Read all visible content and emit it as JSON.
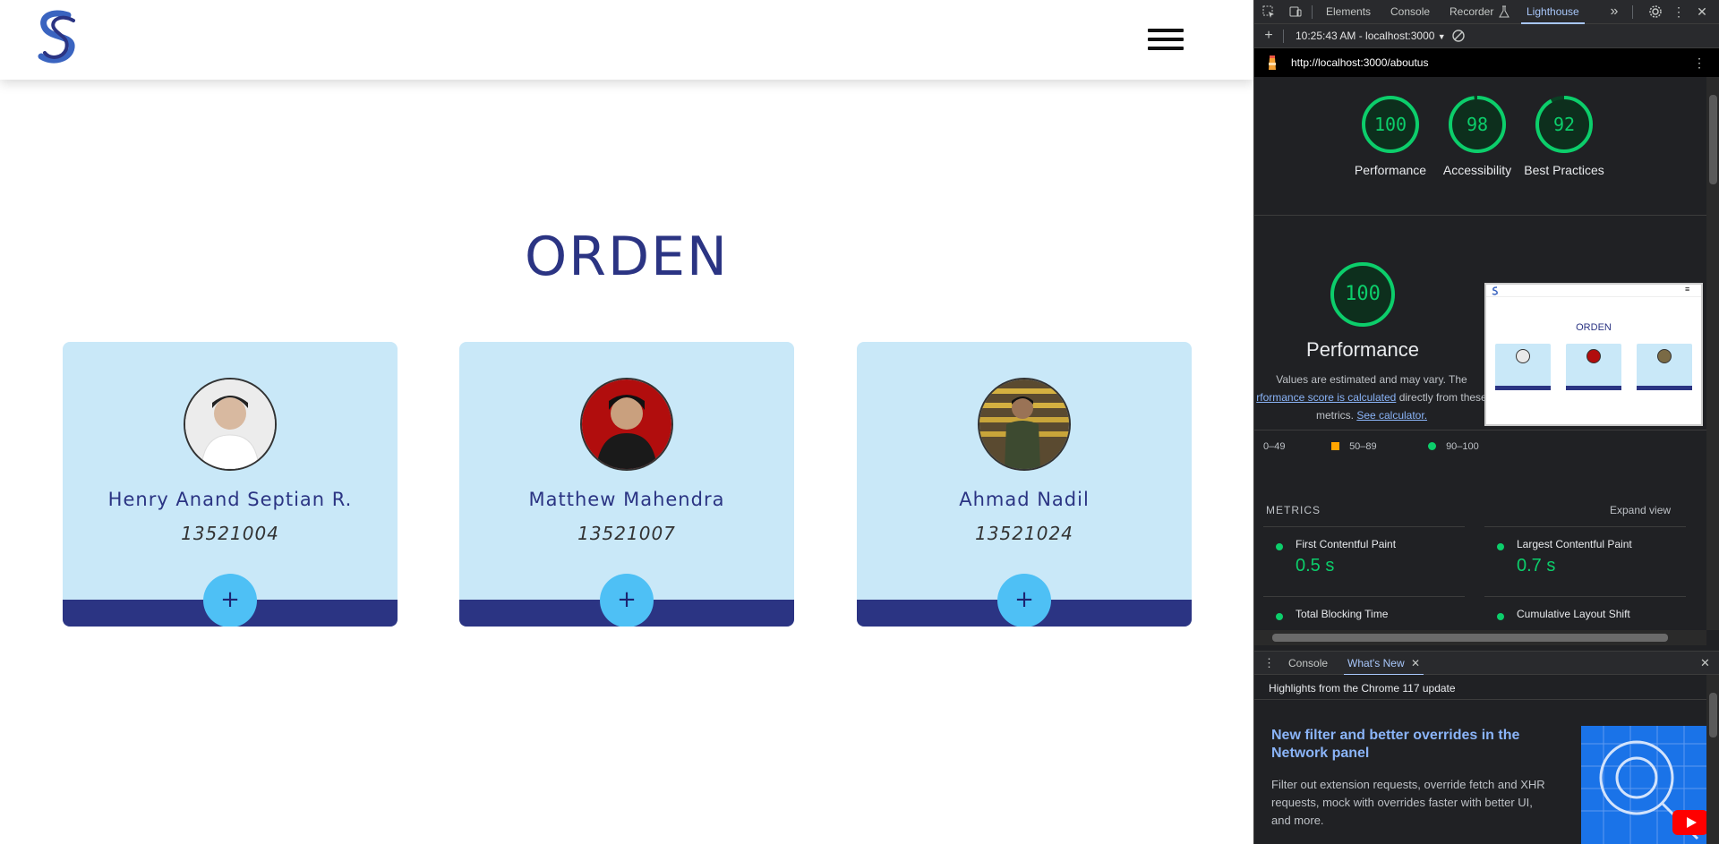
{
  "site": {
    "logo_icon": "orden-s-logo-icon",
    "title": "ORDEN",
    "members": [
      {
        "name": "Henry Anand Septian R.",
        "nim": "13521004",
        "avatar_bg": "#e9e9e9",
        "plus": "+"
      },
      {
        "name": "Matthew Mahendra",
        "nim": "13521007",
        "avatar_bg": "#b10d0d",
        "plus": "+"
      },
      {
        "name": "Ahmad Nadil",
        "nim": "13521024",
        "avatar_bg": "#7a6a45",
        "plus": "+"
      }
    ],
    "colors": {
      "primary": "#2b3483",
      "card_bg": "#c9e8f8",
      "button": "#4ec0f5"
    }
  },
  "devtools": {
    "tabs": [
      "Elements",
      "Console",
      "Recorder",
      "Lighthouse"
    ],
    "active_tab": "Lighthouse",
    "report_selector": "10:25:43 AM - localhost:3000",
    "url": "http://localhost:3000/aboutus",
    "scores": [
      {
        "value": "100",
        "label": "Performance",
        "fraction": 1.0
      },
      {
        "value": "98",
        "label": "Accessibility",
        "fraction": 0.98
      },
      {
        "value": "92",
        "label": "Best Practices",
        "fraction": 0.92
      }
    ],
    "performance": {
      "value": "100",
      "fraction": 1.0,
      "title": "Performance",
      "desc_prefix": "Values are estimated and may vary. The",
      "desc_link1": "rformance score is calculated",
      "desc_mid": "directly from these",
      "desc_suffix": "metrics.",
      "desc_link2": "See calculator."
    },
    "thumbnail": {
      "title": "ORDEN",
      "menu": "≡"
    },
    "legend": [
      {
        "label": "0–49",
        "color": "#ff4e42"
      },
      {
        "label": "50–89",
        "color": "#ffa400"
      },
      {
        "label": "90–100",
        "color": "#0cce6b"
      }
    ],
    "metrics_heading": "METRICS",
    "expand_view": "Expand view",
    "metrics": [
      {
        "label": "First Contentful Paint",
        "value": "0.5 s"
      },
      {
        "label": "Largest Contentful Paint",
        "value": "0.7 s"
      },
      {
        "label": "Total Blocking Time",
        "value": ""
      },
      {
        "label": "Cumulative Layout Shift",
        "value": ""
      }
    ],
    "drawer_tabs": [
      "Console",
      "What's New"
    ],
    "drawer_close": "✕",
    "whats_new": {
      "highlights": "Highlights from the Chrome 117 update",
      "title": "New filter and better overrides in the Network panel",
      "description": "Filter out extension requests, override fetch and XHR requests, mock with overrides faster with better UI, and more."
    }
  }
}
